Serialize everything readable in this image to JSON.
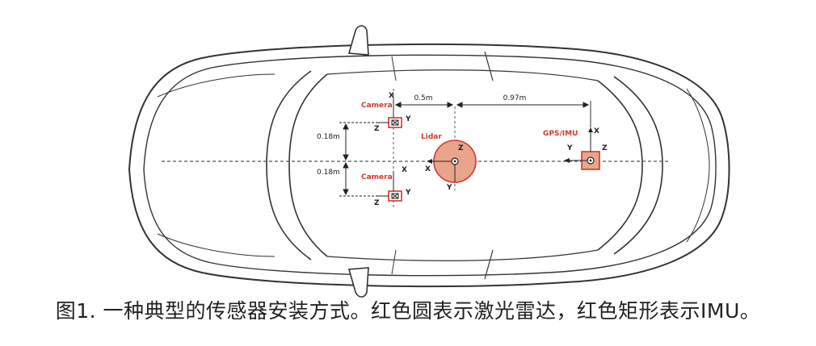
{
  "labels": {
    "camera_top": "Camera",
    "camera_bottom": "Camera",
    "lidar": "Lidar",
    "gps_imu": "GPS/IMU",
    "dist_05": "0.5m",
    "dist_097": "0.97m",
    "dist_018_top": "0.18m",
    "dist_018_bottom": "0.18m"
  },
  "axes": {
    "x": "X",
    "y": "Y",
    "z": "Z"
  },
  "caption": "图1. 一种典型的传感器安装方式。红色圆表示激光雷达，红色矩形表示IMU。",
  "colors": {
    "sensor_red": "#d3372a",
    "lidar_fill": "#e8a58b",
    "outline": "#333333"
  }
}
